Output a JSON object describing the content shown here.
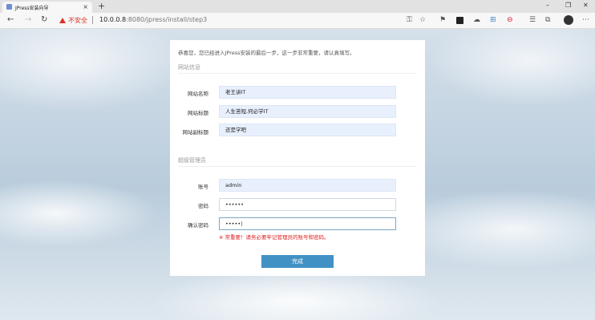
{
  "browser": {
    "tab_title": "JPress安装向导",
    "tab_close": "×",
    "new_tab": "+",
    "insecure_label": "不安全",
    "url_host": "10.0.0.8",
    "url_rest": ":8080/jpress/install/step3",
    "window_minimize": "–",
    "window_restore": "❐",
    "window_close": "✕"
  },
  "form": {
    "intro": "恭喜您，您已经进入JPress安装的最后一步，这一步非常重要，请认真填写。",
    "site_section": "网站信息",
    "site_name_label": "网站名称",
    "site_name_value": "老王讲IT",
    "site_title_label": "网站标题",
    "site_title_value": "人生苦短,何必学IT",
    "site_subtitle_label": "网站副标题",
    "site_subtitle_value": "还是学吧",
    "admin_section": "超级管理员",
    "account_label": "账号",
    "account_value": "admin",
    "password_label": "密码",
    "password_value": "••••••",
    "confirm_label": "确认密码",
    "confirm_value": "•••••|",
    "warning": "※ 常重要！请务必要牢记管理员的账号和密码。",
    "submit_label": "完成"
  }
}
